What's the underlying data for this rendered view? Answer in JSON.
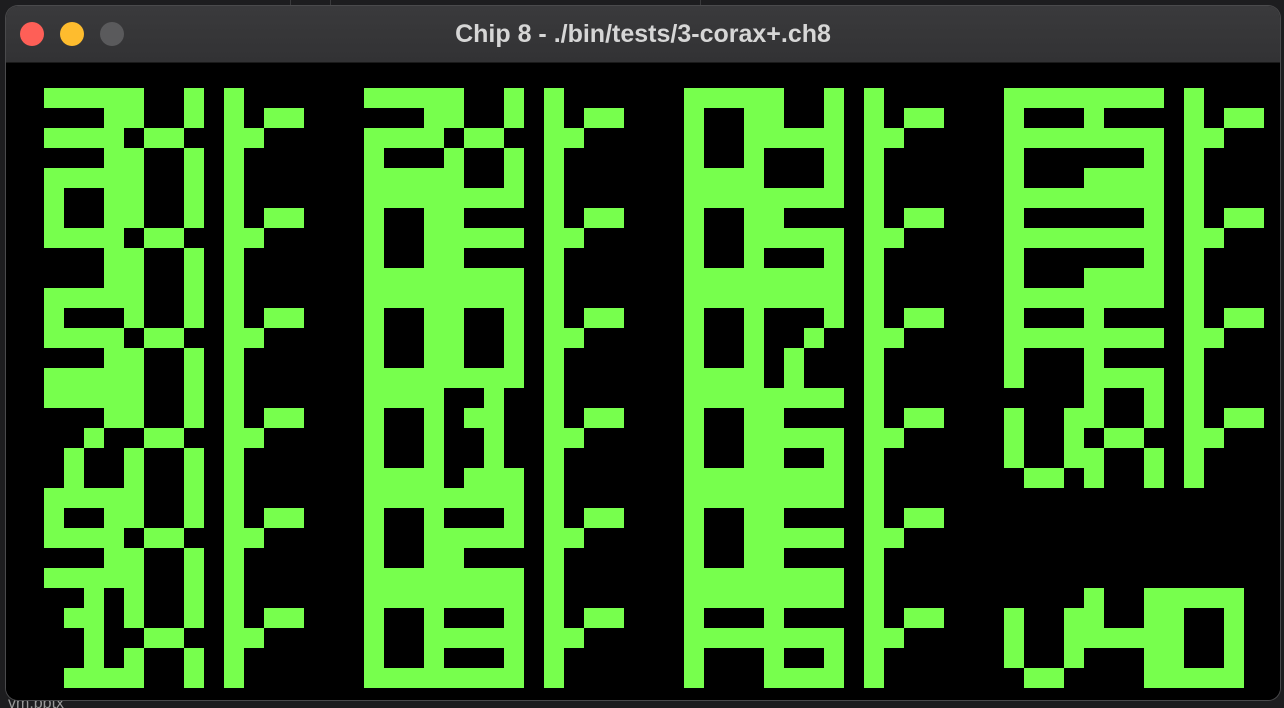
{
  "window": {
    "title": "Chip 8 - ./bin/tests/3-corax+.ch8"
  },
  "desktop": {
    "bottom_peek_text": "vm.pptx"
  },
  "display": {
    "foreground": "#77ff4d",
    "background": "#000000",
    "columns": [
      [
        "3X",
        "4X",
        "5X",
        "7X",
        "9X",
        "1X"
      ],
      [
        "2X",
        "0E",
        "00",
        "01",
        "02",
        "03"
      ],
      [
        "04",
        "05",
        "07",
        "06",
        "0E",
        "F6"
      ],
      [
        "F5",
        "F3",
        "FE",
        "VX",
        "",
        "v4.0"
      ]
    ],
    "status_glyph": "ok-checkmark-icon"
  }
}
